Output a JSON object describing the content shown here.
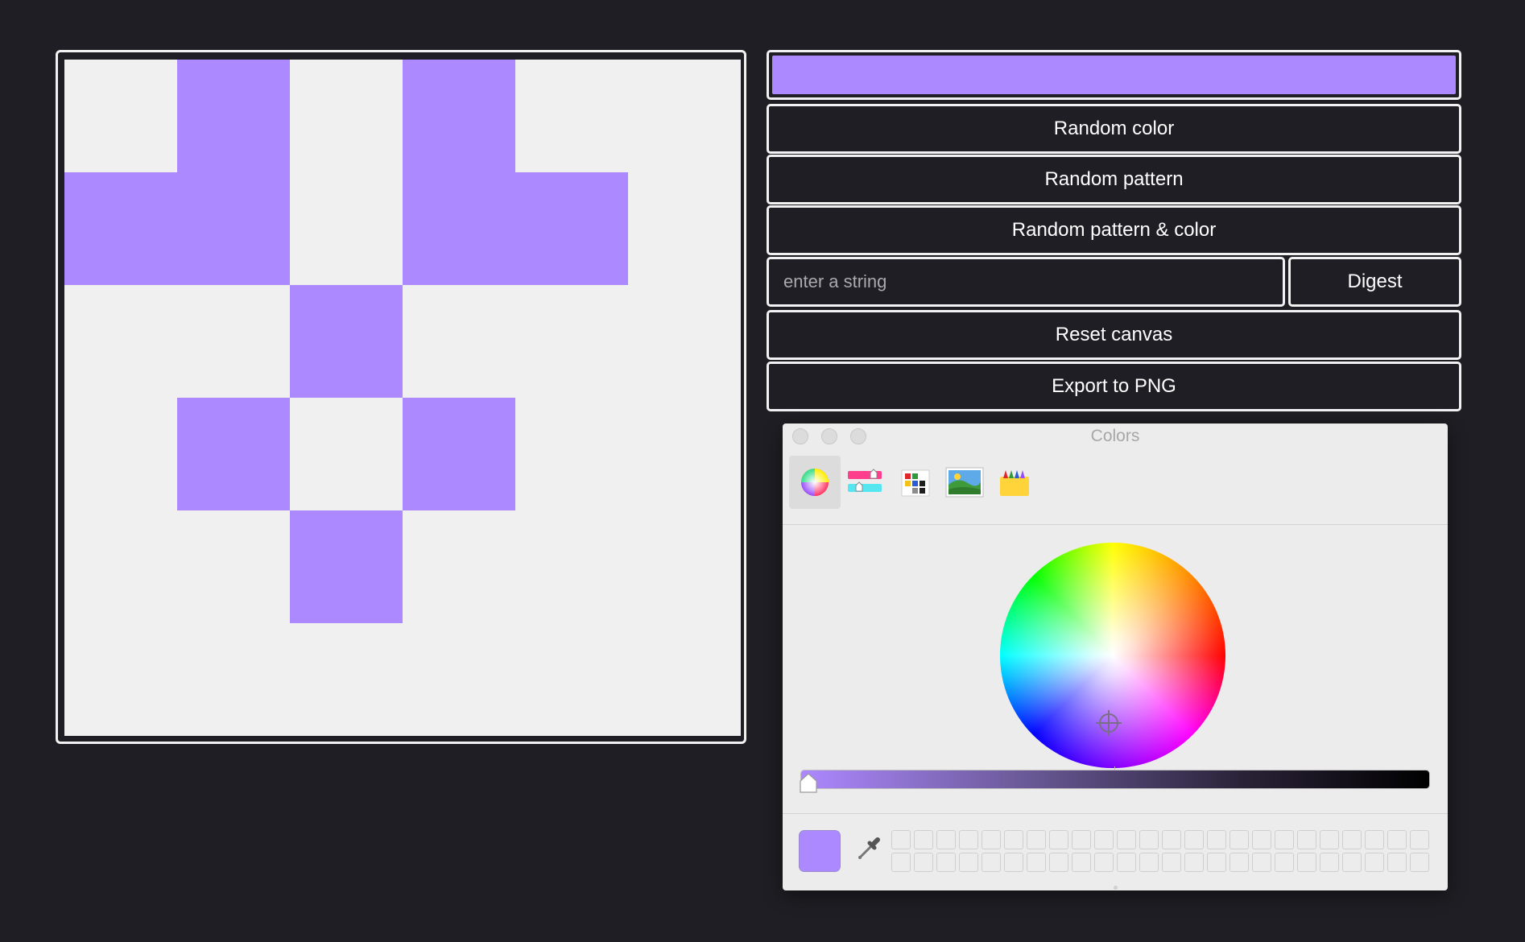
{
  "canvas": {
    "background": "#f0f0f0",
    "fill_color": "#ad89ff",
    "grid_size": 6,
    "filled_cells": [
      [
        0,
        1
      ],
      [
        0,
        3
      ],
      [
        1,
        0
      ],
      [
        1,
        1
      ],
      [
        1,
        3
      ],
      [
        1,
        4
      ],
      [
        2,
        2
      ],
      [
        3,
        1
      ],
      [
        3,
        3
      ],
      [
        4,
        2
      ]
    ]
  },
  "controls": {
    "current_color": "#ad89ff",
    "random_color_label": "Random color",
    "random_pattern_label": "Random pattern",
    "random_pattern_color_label": "Random pattern & color",
    "string_input_value": "",
    "string_input_placeholder": "enter a string",
    "digest_label": "Digest",
    "reset_label": "Reset canvas",
    "export_label": "Export to PNG"
  },
  "color_panel": {
    "title": "Colors",
    "tools": [
      "color-wheel-icon",
      "color-sliders-icon",
      "color-palettes-icon",
      "image-palettes-icon",
      "pencils-icon"
    ],
    "selected_tool": "color-wheel-icon",
    "brightness": 1.0,
    "selected_color": "#ad89ff",
    "swatch_slots": 48
  }
}
